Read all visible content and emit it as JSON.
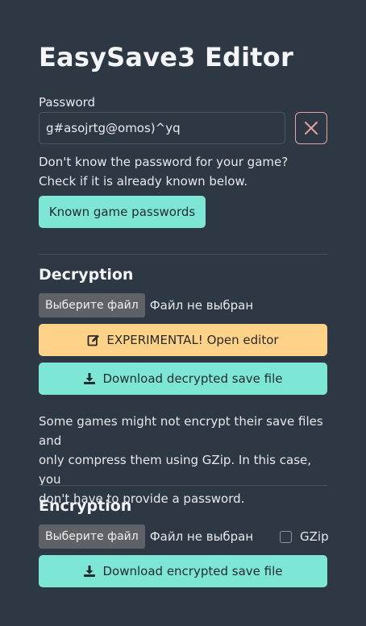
{
  "app": {
    "title": "EasySave3 Editor"
  },
  "password": {
    "label": "Password",
    "value": "g#asojrtg@omos)^yq"
  },
  "hint": {
    "line1": "Don't know the password for your game?",
    "line2": "Check if it is already known below."
  },
  "known_passwords_button": "Known game passwords",
  "decryption": {
    "title": "Decryption",
    "file_button": "Выберите файл",
    "file_status": "Файл не выбран",
    "editor_button": "EXPERIMENTAL! Open editor",
    "download_button": "Download decrypted save file",
    "note_line1": "Some games might not encrypt their save files and",
    "note_line2": "only compress them using GZip. In this case, you",
    "note_line3": "don't have to provide a password."
  },
  "encryption": {
    "title": "Encryption",
    "file_button": "Выберите файл",
    "file_status": "Файл не выбран",
    "gzip_label": "GZip",
    "gzip_checked": false,
    "download_button": "Download encrypted save file"
  },
  "icons": {
    "clear": "close-icon",
    "edit": "edit-icon",
    "download": "download-icon"
  },
  "colors": {
    "background": "#2e3744",
    "accent_teal": "#7ee6d4",
    "warning_orange": "#ffd28a",
    "danger_outline": "#e7a3a3"
  }
}
